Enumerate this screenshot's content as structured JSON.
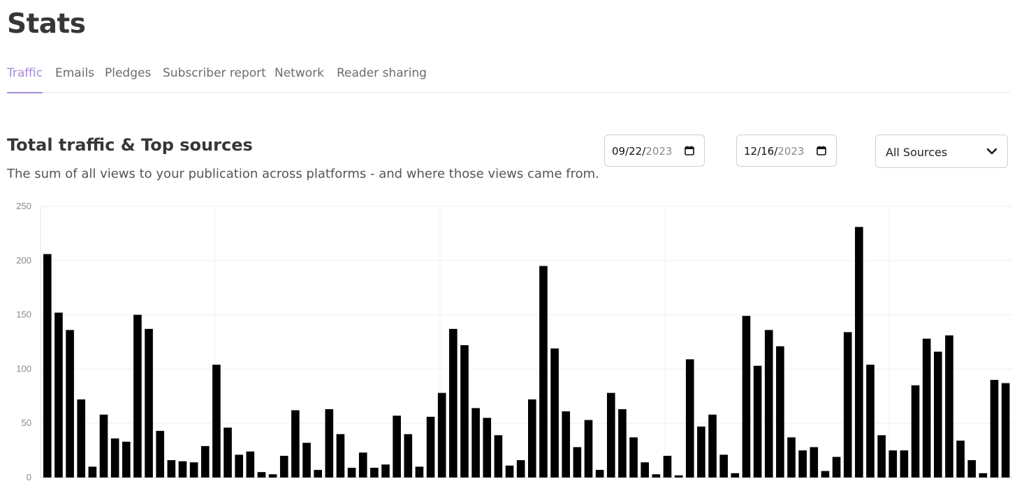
{
  "page": {
    "title": "Stats"
  },
  "tabs": [
    {
      "label": "Traffic",
      "active": true
    },
    {
      "label": "Emails",
      "active": false
    },
    {
      "label": "Pledges",
      "active": false
    },
    {
      "label": "Subscriber report",
      "active": false
    },
    {
      "label": "Network",
      "active": false
    },
    {
      "label": "Reader sharing",
      "active": false
    }
  ],
  "section": {
    "title": "Total traffic & Top sources",
    "description": "The sum of all views to your publication across platforms - and where those views came from."
  },
  "filters": {
    "start_date": {
      "month_day": "09/22/",
      "year": "2023"
    },
    "end_date": {
      "month_day": "12/16/",
      "year": "2023"
    },
    "source": {
      "selected": "All Sources"
    }
  },
  "colors": {
    "accent": "#a58bd8",
    "bar": "#000000",
    "text": "#363737"
  },
  "icons": {
    "date": "calendar-icon",
    "select": "chevron-down-icon"
  },
  "chart_data": {
    "type": "bar",
    "x_start": "2023-09-22",
    "x_end": "2023-12-16",
    "ylim": [
      0,
      250
    ],
    "yticks": [
      0,
      50,
      100,
      150,
      200,
      250
    ],
    "grid": true,
    "series": [
      {
        "values": [
          206,
          152,
          136,
          72,
          10,
          58,
          36,
          33,
          150,
          137,
          43,
          16,
          15,
          14,
          29,
          104,
          46,
          21,
          24,
          5,
          3,
          20,
          62,
          32,
          7,
          63,
          40,
          9,
          23,
          9,
          12,
          57,
          40,
          10,
          56,
          78,
          137,
          122,
          64,
          55,
          39,
          11,
          16,
          72,
          195,
          119,
          61,
          28,
          53,
          7,
          78,
          63,
          37,
          14,
          3,
          20,
          2,
          109,
          47,
          58,
          21,
          4,
          149,
          103,
          136,
          121,
          37,
          25,
          28,
          6,
          19,
          134,
          231,
          104,
          39,
          25,
          25,
          85,
          128,
          116,
          131,
          34,
          16,
          4,
          90,
          87
        ]
      }
    ]
  }
}
